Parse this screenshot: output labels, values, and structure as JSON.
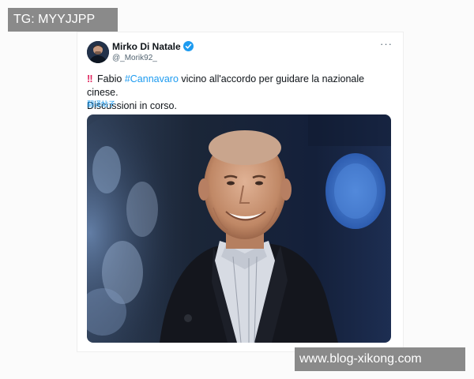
{
  "watermarks": {
    "top_left": "TG: MYYJJPP",
    "bottom_right": "www.blog-xikong.com"
  },
  "tweet": {
    "author": {
      "name": "Mirko Di Natale",
      "handle": "@_Morik92_",
      "verified": true
    },
    "more_icon": "···",
    "alert_glyph": "‼",
    "text_before_hashtag": "Fabio",
    "hashtag": "#Cannavaro",
    "text_after_hashtag": "vicino all'accordo per guidare la nazionale cinese.",
    "text_line2": "Discussioni in corso.",
    "translate_label": "翻译帖子",
    "media": {
      "icon": "photo-of-smiling-man-in-dark-blazer"
    }
  },
  "colors": {
    "accent": "#1d9bf0",
    "alert": "#e0245e",
    "text": "#0f1419",
    "muted": "#536471",
    "badge_bg": "#8a8a8a"
  }
}
